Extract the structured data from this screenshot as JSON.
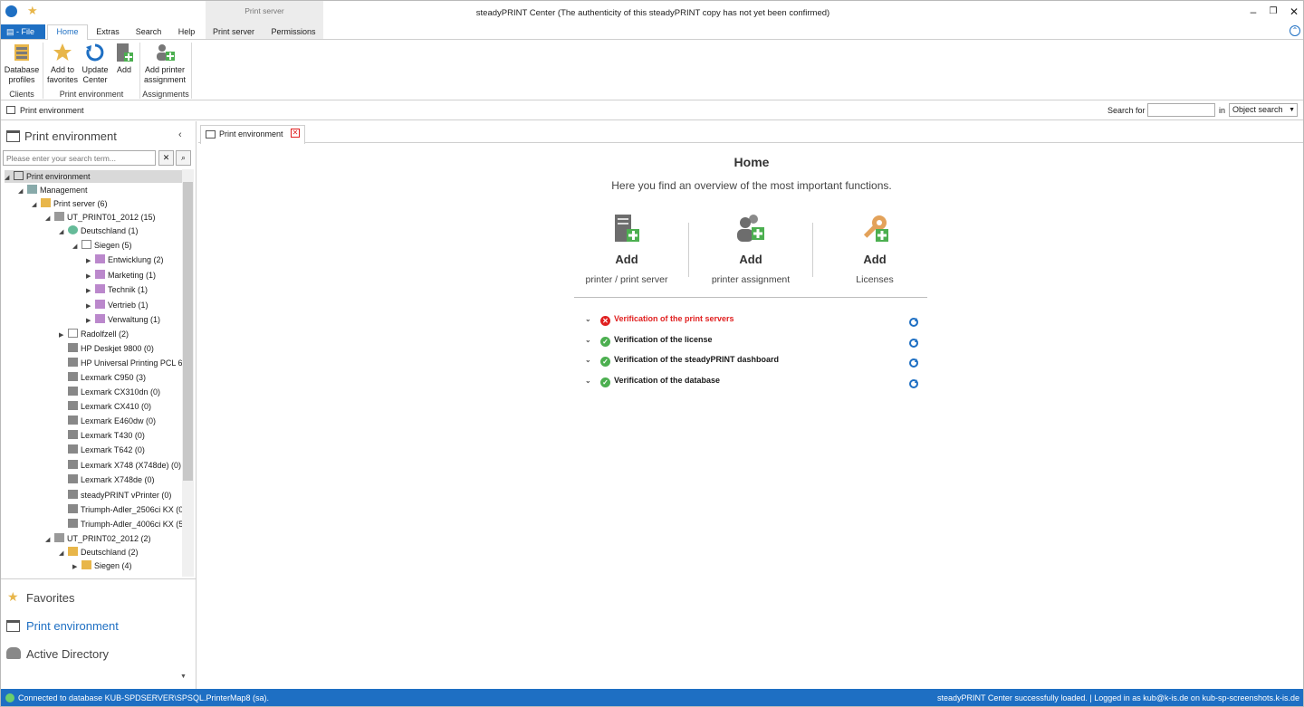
{
  "window": {
    "title": "steadyPRINT Center (The authenticity of this steadyPRINT copy has not yet been confirmed)"
  },
  "ribbon": {
    "file_label": "File",
    "tabs": [
      "Home",
      "Extras",
      "Search",
      "Help",
      "Print server",
      "Permissions"
    ],
    "context_group_label": "Print server",
    "buttons": {
      "database_profiles": "Database profiles",
      "add_to_favorites": "Add to favorites",
      "update_center": "Update Center",
      "add": "Add",
      "add_printer_assignment": "Add printer assignment"
    },
    "groups": [
      "Clients",
      "Print environment",
      "Assignments"
    ]
  },
  "addressbar": {
    "breadcrumb": "Print environment",
    "search_for_label": "Search for",
    "search_value": "",
    "in_label": "in",
    "scope": "Object search"
  },
  "left_panel": {
    "title": "Print environment",
    "search_placeholder": "Please enter your search term...",
    "tree": [
      "Print environment",
      "Management",
      "Print server (6)",
      "UT_PRINT01_2012 (15)",
      "Deutschland (1)",
      "Siegen (5)",
      "Entwicklung (2)",
      "Marketing (1)",
      "Technik (1)",
      "Vertrieb (1)",
      "Verwaltung (1)",
      "Radolfzell (2)",
      "HP Deskjet 9800 (0)",
      "HP Universal Printing PCL 6",
      "Lexmark C950 (3)",
      "Lexmark CX310dn (0)",
      "Lexmark CX410 (0)",
      "Lexmark E460dw (0)",
      "Lexmark T430 (0)",
      "Lexmark T642 (0)",
      "Lexmark X748 (X748de) (0)",
      "Lexmark X748de (0)",
      "steadyPRINT vPrinter (0)",
      "Triumph-Adler_2506ci KX (0",
      "Triumph-Adler_4006ci KX (5",
      "UT_PRINT02_2012 (2)",
      "Deutschland (2)",
      "Siegen (4)"
    ],
    "nav": [
      "Favorites",
      "Print environment",
      "Active Directory"
    ]
  },
  "main": {
    "tab_label": "Print environment",
    "title": "Home",
    "subtitle": "Here you find an overview of the most important functions.",
    "tiles": [
      {
        "action": "Add",
        "label": "printer / print server"
      },
      {
        "action": "Add",
        "label": "printer assignment"
      },
      {
        "action": "Add",
        "label": "Licenses"
      }
    ],
    "verifications": [
      {
        "label": "Verification of the print servers",
        "status": "error"
      },
      {
        "label": "Verification of the license",
        "status": "ok"
      },
      {
        "label": "Verification of the steadyPRINT dashboard",
        "status": "ok"
      },
      {
        "label": "Verification of the database",
        "status": "ok"
      }
    ],
    "colors": {
      "error": "#e02020",
      "ok": "#4caf50",
      "accent": "#1e6fc3"
    }
  },
  "status": {
    "left": "Connected to database KUB-SPDSERVER\\SPSQL.PrinterMap8 (sa).",
    "right": "steadyPRINT Center successfully loaded. | Logged in as kub@k-is.de on kub-sp-screenshots.k-is.de"
  }
}
